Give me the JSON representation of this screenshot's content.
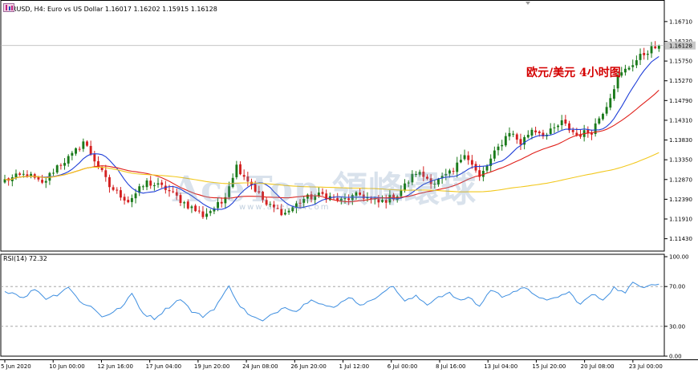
{
  "header": {
    "title": "EURUSD, H4:  Euro vs US Dollar  1.16017 1.16202 1.15915 1.16128"
  },
  "annotation": "欧元/美元 4小时图",
  "watermark": {
    "text": "AceTop 領峰環球",
    "url": "www.acetop.com"
  },
  "colors": {
    "bull": "#1a7a1a",
    "bear": "#d42020",
    "ma_fast": "#1f3fd8",
    "ma_mid": "#e0201a",
    "ma_slow": "#f2c81e",
    "rsi": "#3f8fe0",
    "current_price_box": "#c8c8c8"
  },
  "chart_data": [
    {
      "type": "candlestick",
      "title": "EURUSD, H4:  Euro vs US Dollar  1.16017 1.16202 1.15915 1.16128",
      "ylabel": "",
      "ylim": [
        1.1113,
        1.17
      ],
      "y_ticks": [
        "1.16710",
        "1.16230",
        "1.15750",
        "1.15270",
        "1.14790",
        "1.14310",
        "1.13830",
        "1.13350",
        "1.12870",
        "1.12390",
        "1.11910",
        "1.11430"
      ],
      "current_price": "1.16128",
      "x_ticks": [
        "5 Jun 2020",
        "10 Jun 00:00",
        "12 Jun 16:00",
        "17 Jun 04:00",
        "19 Jun 20:00",
        "24 Jun 08:00",
        "26 Jun 20:00",
        "1 Jul 12:00",
        "6 Jul 00:00",
        "8 Jul 16:00",
        "13 Jul 04:00",
        "15 Jul 20:00",
        "20 Jul 08:00",
        "23 Jul 00:00"
      ],
      "anchors": [
        [
          0,
          1.1285
        ],
        [
          6,
          1.13
        ],
        [
          10,
          1.1275
        ],
        [
          14,
          1.132
        ],
        [
          18,
          1.1345
        ],
        [
          21,
          1.138
        ],
        [
          24,
          1.1335
        ],
        [
          28,
          1.127
        ],
        [
          33,
          1.1235
        ],
        [
          38,
          1.128
        ],
        [
          43,
          1.1265
        ],
        [
          48,
          1.123
        ],
        [
          53,
          1.12
        ],
        [
          58,
          1.123
        ],
        [
          62,
          1.132
        ],
        [
          66,
          1.1275
        ],
        [
          70,
          1.1225
        ],
        [
          75,
          1.1205
        ],
        [
          80,
          1.124
        ],
        [
          85,
          1.125
        ],
        [
          90,
          1.1235
        ],
        [
          95,
          1.125
        ],
        [
          100,
          1.123
        ],
        [
          105,
          1.125
        ],
        [
          110,
          1.1305
        ],
        [
          115,
          1.128
        ],
        [
          120,
          1.1305
        ],
        [
          123,
          1.1355
        ],
        [
          127,
          1.129
        ],
        [
          131,
          1.135
        ],
        [
          135,
          1.1405
        ],
        [
          138,
          1.1375
        ],
        [
          141,
          1.141
        ],
        [
          145,
          1.1395
        ],
        [
          149,
          1.1425
        ],
        [
          153,
          1.1395
        ],
        [
          157,
          1.1405
        ],
        [
          161,
          1.147
        ],
        [
          164,
          1.1535
        ],
        [
          168,
          1.157
        ],
        [
          172,
          1.16
        ],
        [
          175,
          1.1613
        ]
      ],
      "series": [
        {
          "name": "",
          "role": "fast moving average",
          "period": 10
        },
        {
          "name": "",
          "role": "medium moving average",
          "period": 24
        },
        {
          "name": "",
          "role": "slow moving average",
          "period": 100
        }
      ]
    },
    {
      "type": "line",
      "title": "RSI(14) 72.32",
      "ylim": [
        0,
        100
      ],
      "y_ticks": [
        "100.00",
        "70.00",
        "30.00",
        "0.00"
      ],
      "levels": [
        70,
        30
      ],
      "last_value": 72.32,
      "anchors": [
        [
          0,
          65
        ],
        [
          3,
          63
        ],
        [
          5,
          58
        ],
        [
          8,
          68
        ],
        [
          11,
          58
        ],
        [
          14,
          62
        ],
        [
          17,
          70
        ],
        [
          20,
          55
        ],
        [
          23,
          50
        ],
        [
          26,
          40
        ],
        [
          29,
          44
        ],
        [
          32,
          52
        ],
        [
          34,
          63
        ],
        [
          37,
          43
        ],
        [
          40,
          38
        ],
        [
          43,
          47
        ],
        [
          47,
          58
        ],
        [
          50,
          45
        ],
        [
          53,
          40
        ],
        [
          56,
          48
        ],
        [
          60,
          70
        ],
        [
          63,
          50
        ],
        [
          66,
          40
        ],
        [
          69,
          35
        ],
        [
          72,
          43
        ],
        [
          75,
          50
        ],
        [
          78,
          45
        ],
        [
          82,
          58
        ],
        [
          85,
          52
        ],
        [
          88,
          48
        ],
        [
          92,
          60
        ],
        [
          95,
          52
        ],
        [
          98,
          55
        ],
        [
          101,
          65
        ],
        [
          104,
          70
        ],
        [
          107,
          55
        ],
        [
          110,
          60
        ],
        [
          113,
          52
        ],
        [
          116,
          60
        ],
        [
          119,
          63
        ],
        [
          122,
          55
        ],
        [
          124,
          60
        ],
        [
          127,
          50
        ],
        [
          130,
          67
        ],
        [
          133,
          60
        ],
        [
          136,
          65
        ],
        [
          139,
          68
        ],
        [
          142,
          62
        ],
        [
          145,
          55
        ],
        [
          148,
          60
        ],
        [
          151,
          64
        ],
        [
          154,
          52
        ],
        [
          157,
          62
        ],
        [
          160,
          57
        ],
        [
          163,
          69
        ],
        [
          166,
          63
        ],
        [
          168,
          74
        ],
        [
          171,
          70
        ],
        [
          173,
          73
        ],
        [
          175,
          72.32
        ]
      ]
    }
  ]
}
